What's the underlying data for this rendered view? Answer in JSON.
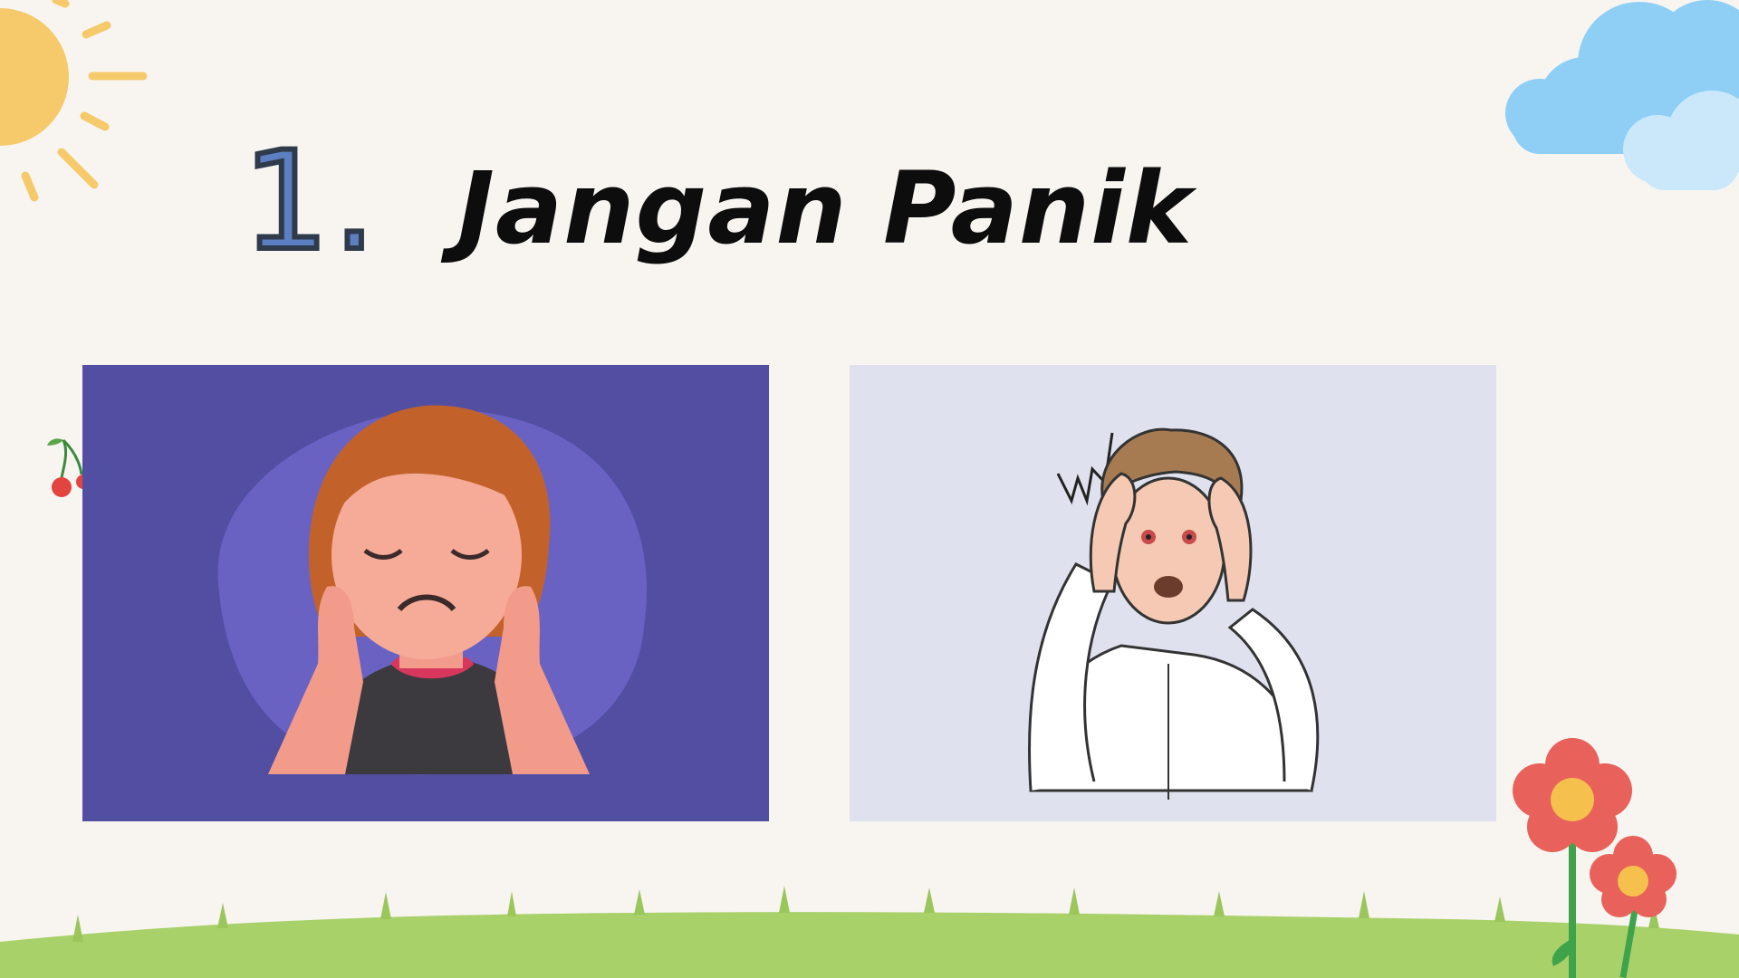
{
  "slide": {
    "number": "1.",
    "title": "Jangan Panik"
  },
  "images": [
    {
      "name": "woman-headache-illustration",
      "background": "#524fa3"
    },
    {
      "name": "man-panic-illustration",
      "background": "#dfe2ee"
    }
  ],
  "decorations": [
    "sun-icon",
    "cloud-icon",
    "cherry-icon",
    "grass",
    "flower-icon"
  ],
  "colors": {
    "background": "#f8f5f1",
    "number": "#5b7fc1",
    "title": "#0d0d0d",
    "sun": "#f6c96a",
    "cloud": "#8fcff5",
    "grass": "#a9d16a",
    "flower": "#e8615a"
  }
}
